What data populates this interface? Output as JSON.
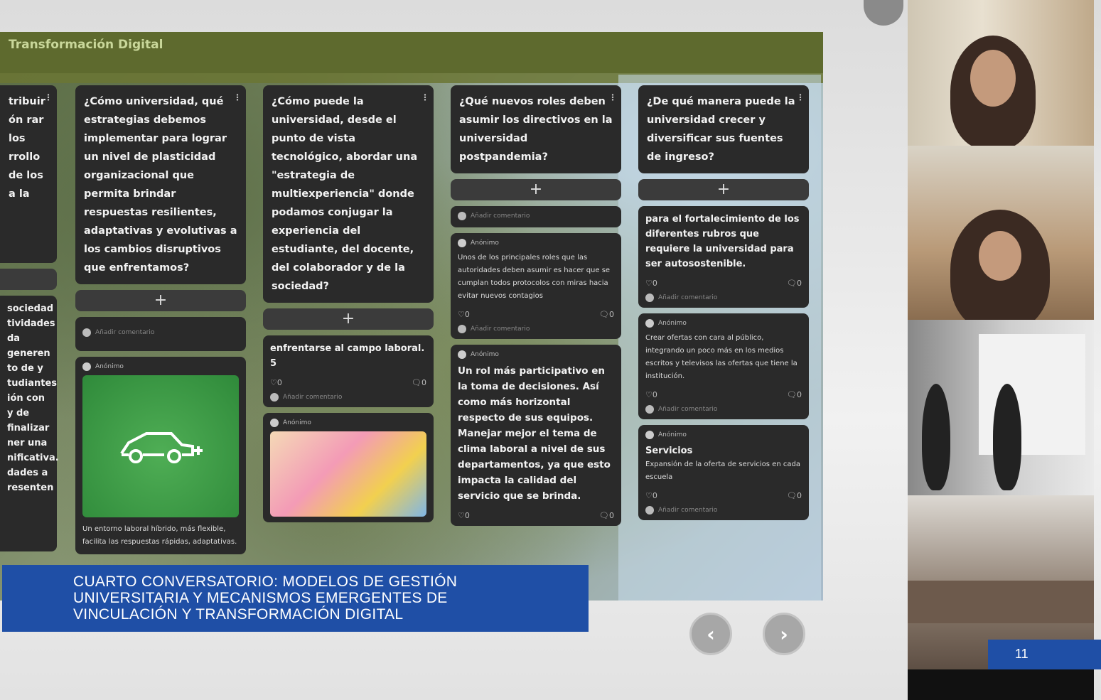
{
  "board": {
    "title": "Transformación Digital",
    "add_symbol": "+",
    "menu_symbol": "⋮",
    "comment_placeholder": "Añadir comentario",
    "author": "Anónimo",
    "likes": "♡0",
    "comments": "🗨0",
    "columns": [
      {
        "question": "tribuir ón rar los rrollo de los a la",
        "post_text": "sociedad tividades da generen to de y tudiantes ión con y de finalizar ner una nificativa. dades a resenten"
      },
      {
        "question": "¿Cómo universidad, qué estrategias debemos implementar para lograr un nivel de plasticidad organizacional que permita brindar respuestas resilientes, adaptativas y evolutivas a los cambios disruptivos que enfrentamos?",
        "post_text": "Un entorno laboral híbrido, más flexible, facilita las respuestas rápidas, adaptativas."
      },
      {
        "question": "¿Cómo puede la universidad, desde el punto de vista tecnológico, abordar una \"estrategia de multiexperiencia\" donde podamos conjugar la experiencia del estudiante, del docente, del colaborador y de la sociedad?",
        "post_text": "enfrentarse al campo laboral.",
        "post_extra": "5"
      },
      {
        "question": "¿Qué nuevos roles deben asumir los directivos en la universidad postpandemia?",
        "post1": "Unos de los principales roles que las autoridades deben asumir es hacer que se cumplan todos protocolos con miras hacia evitar nuevos contagios",
        "post2": "Un rol más participativo en la toma de decisiones. Así como más horizontal respecto de sus equipos. Manejar mejor el tema de clima laboral a nivel de sus departamentos, ya que esto impacta la calidad del servicio que se brinda."
      },
      {
        "question": "¿De qué manera puede la universidad crecer y diversificar sus fuentes de ingreso?",
        "post1": "para el fortalecimiento de los diferentes rubros que requiere la universidad para ser autosostenible.",
        "post2": "Crear ofertas con cara al público, integrando un poco más en los medios escritos y televisos las ofertas que tiene la institución.",
        "post3_title": "Servicios",
        "post3": "Expansión de la oferta de servicios en cada escuela"
      }
    ]
  },
  "nav": {
    "prev": "‹",
    "next": "›"
  },
  "caption": {
    "line1": "CUARTO CONVERSATORIO: MODELOS DE GESTIÓN",
    "line2": "UNIVERSITARIA Y MECANISMOS EMERGENTES DE",
    "line3": "VINCULACIÓN Y TRANSFORMACIÓN DIGITAL"
  },
  "slide_number": "11"
}
